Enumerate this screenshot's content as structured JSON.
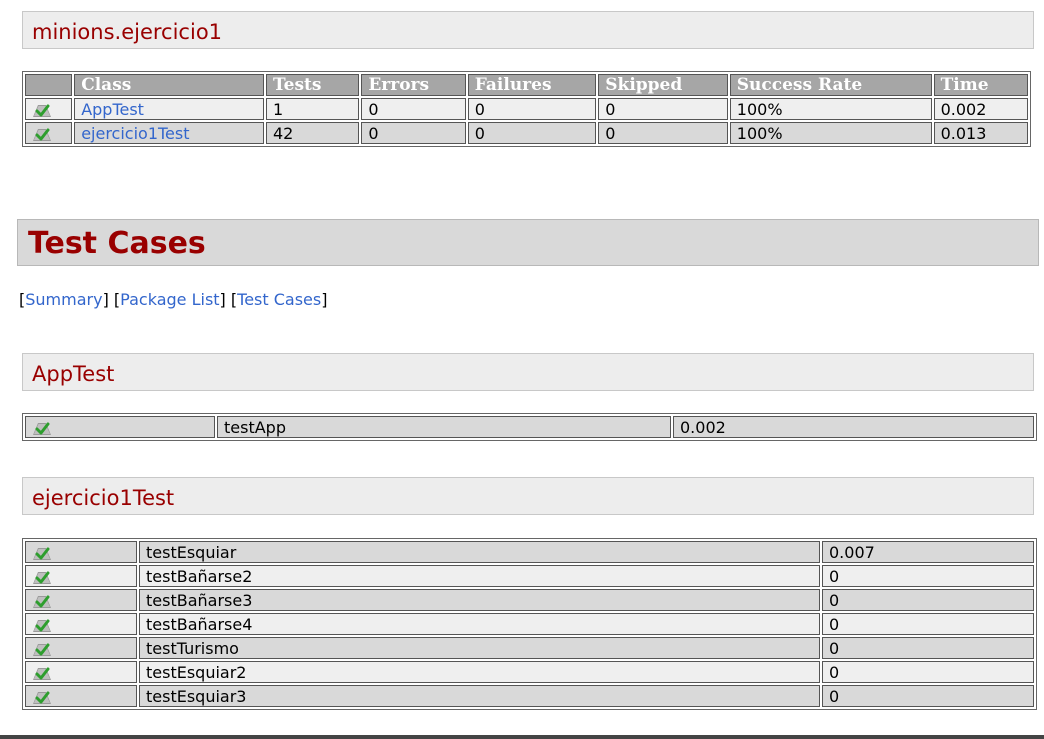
{
  "package_header": "minions.ejercicio1",
  "summary_table": {
    "columns": [
      "Class",
      "Tests",
      "Errors",
      "Failures",
      "Skipped",
      "Success Rate",
      "Time"
    ],
    "rows": [
      {
        "class": "AppTest",
        "tests": "1",
        "errors": "0",
        "failures": "0",
        "skipped": "0",
        "success_rate": "100%",
        "time": "0.002"
      },
      {
        "class": "ejercicio1Test",
        "tests": "42",
        "errors": "0",
        "failures": "0",
        "skipped": "0",
        "success_rate": "100%",
        "time": "0.013"
      }
    ]
  },
  "test_cases_heading": "Test Cases",
  "nav": {
    "open1": "[",
    "summary": "Summary",
    "close1": "]",
    "open2": "[",
    "package_list": "Package List",
    "close2": "]",
    "open3": "[",
    "test_cases": "Test Cases",
    "close3": "]"
  },
  "apptest": {
    "header": "AppTest",
    "rows": [
      {
        "name": "testApp",
        "time": "0.002"
      }
    ]
  },
  "ejercicio1test": {
    "header": "ejercicio1Test",
    "rows": [
      {
        "name": "testEsquiar",
        "time": "0.007"
      },
      {
        "name": "testBañarse2",
        "time": "0"
      },
      {
        "name": "testBañarse3",
        "time": "0"
      },
      {
        "name": "testBañarse4",
        "time": "0"
      },
      {
        "name": "testTurismo",
        "time": "0"
      },
      {
        "name": "testEsquiar2",
        "time": "0"
      },
      {
        "name": "testEsquiar3",
        "time": "0"
      }
    ]
  },
  "icons": {
    "pass": "pass-icon"
  },
  "colors": {
    "heading": "#990000",
    "link": "#3366cc",
    "header_bg": "#a6a6a6"
  }
}
